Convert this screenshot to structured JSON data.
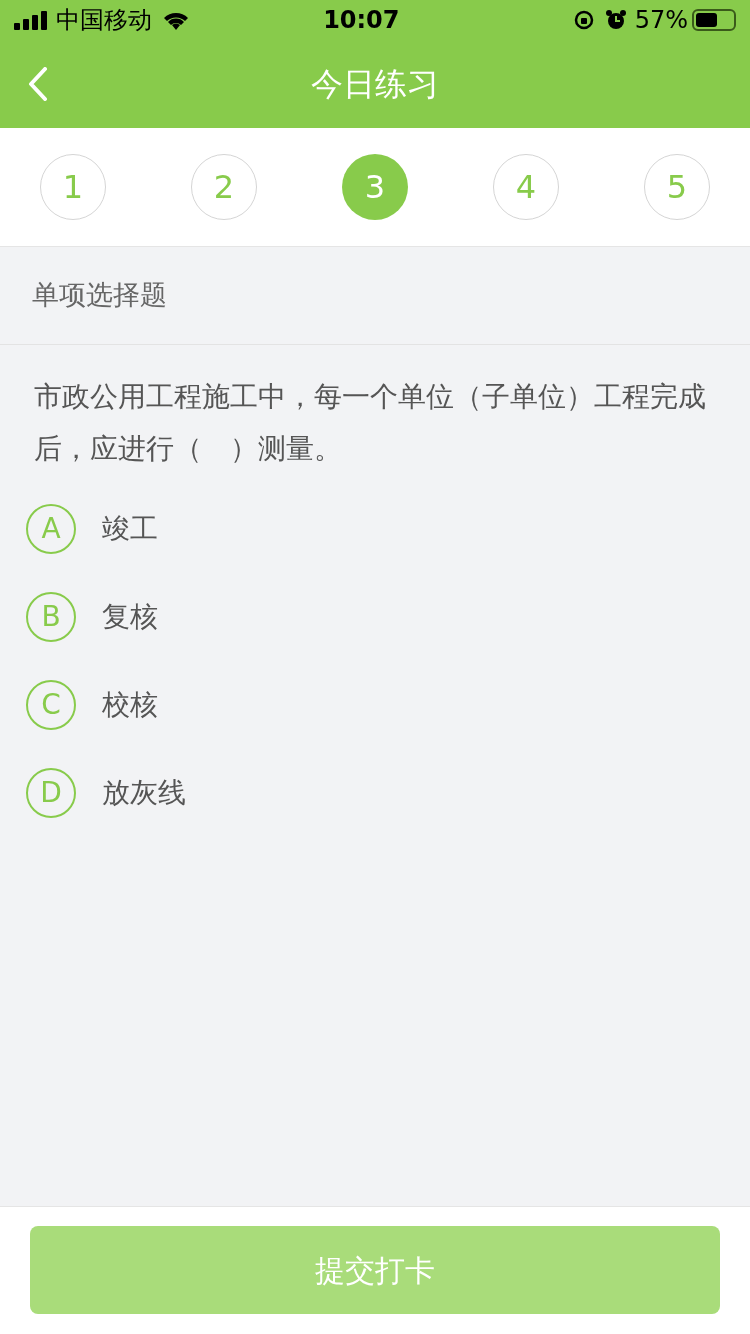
{
  "status_bar": {
    "carrier": "中国移动",
    "time": "10:07",
    "battery": "57%"
  },
  "nav": {
    "title": "今日练习"
  },
  "steps": [
    {
      "label": "1",
      "selected": false
    },
    {
      "label": "2",
      "selected": false
    },
    {
      "label": "3",
      "selected": true
    },
    {
      "label": "4",
      "selected": false
    },
    {
      "label": "5",
      "selected": false
    }
  ],
  "section": {
    "title": "单项选择题"
  },
  "question": {
    "text": "市政公用工程施工中，每一个单位（子单位）工程完成后，应进行（　）测量。"
  },
  "options": [
    {
      "letter": "A",
      "text": "竣工",
      "selected": false
    },
    {
      "letter": "B",
      "text": "复核",
      "selected": false
    },
    {
      "letter": "C",
      "text": "校核",
      "selected": false
    },
    {
      "letter": "D",
      "text": "放灰线",
      "selected": false
    }
  ],
  "submit": {
    "label": "提交打卡",
    "disabled": true
  }
}
